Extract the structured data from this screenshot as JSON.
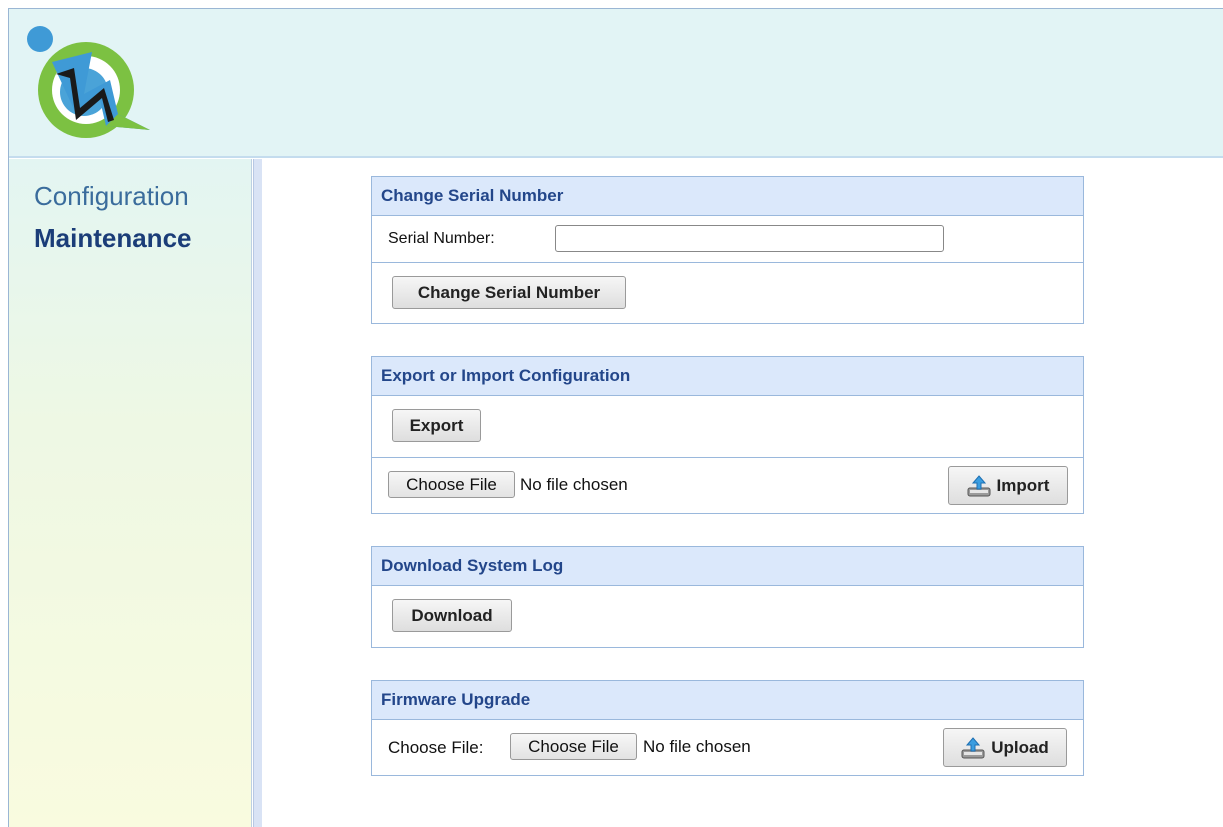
{
  "sidebar": {
    "items": [
      {
        "label": "Configuration"
      },
      {
        "label": "Maintenance"
      }
    ]
  },
  "serial_panel": {
    "title": "Change Serial Number",
    "field_label": "Serial Number:",
    "field_value": "",
    "button_label": "Change Serial Number"
  },
  "config_panel": {
    "title": "Export or Import Configuration",
    "export_label": "Export",
    "choose_file_label": "Choose File",
    "file_status": "No file chosen",
    "import_label": "Import",
    "import_icon": "upload-arrow-icon"
  },
  "log_panel": {
    "title": "Download System Log",
    "download_label": "Download"
  },
  "firmware_panel": {
    "title": "Firmware Upgrade",
    "field_label": "Choose File:",
    "choose_file_label": "Choose File",
    "file_status": "No file chosen",
    "upload_label": "Upload",
    "upload_icon": "upload-arrow-icon"
  },
  "colors": {
    "header_bg": "#e2f4f5",
    "panel_title_bg": "#dbe8fb",
    "panel_title_text": "#23468a",
    "nav_active": "#1b3d78",
    "nav_inactive": "#3a6c9c"
  }
}
